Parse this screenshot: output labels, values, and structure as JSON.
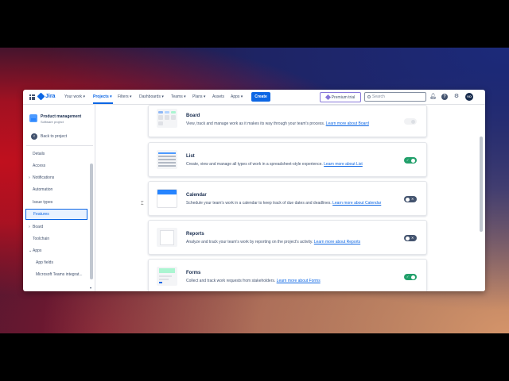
{
  "nav": {
    "logo": "Jira",
    "items": [
      "Your work ▾",
      "Projects ▾",
      "Filters ▾",
      "Dashboards ▾",
      "Teams ▾",
      "Plans ▾",
      "Assets",
      "Apps ▾"
    ],
    "create": "Create",
    "premium": "Premium trial",
    "search_placeholder": "Search",
    "avatar_initials": "VO"
  },
  "sidebar": {
    "project_name": "Product management",
    "project_type": "Software project",
    "back": "Back to project",
    "items": [
      {
        "label": "Details",
        "chevron": ""
      },
      {
        "label": "Access",
        "chevron": ""
      },
      {
        "label": "Notifications",
        "chevron": "›"
      },
      {
        "label": "Automation",
        "chevron": ""
      },
      {
        "label": "Issue types",
        "chevron": ""
      },
      {
        "label": "Features",
        "chevron": ""
      },
      {
        "label": "Board",
        "chevron": "›"
      },
      {
        "label": "Toolchain",
        "chevron": ""
      },
      {
        "label": "Apps",
        "chevron": "⌄"
      },
      {
        "label": "App fields",
        "chevron": ""
      },
      {
        "label": "Microsoft Teams integrat...",
        "chevron": ""
      }
    ]
  },
  "features": [
    {
      "title": "Board",
      "desc": "View, track and manage work as it makes its way through your team's process.",
      "link": "Learn more about Board",
      "toggle": "disabled"
    },
    {
      "title": "List",
      "desc": "Create, view and manage all types of work in a spreadsheet-style experience.",
      "link": "Learn more about List",
      "toggle": "on"
    },
    {
      "title": "Calendar",
      "desc": "Schedule your team's work in a calendar to keep track of due dates and deadlines.",
      "link": "Learn more about Calendar",
      "toggle": "off"
    },
    {
      "title": "Reports",
      "desc": "Analyze and track your team's work by reporting on the project's activity.",
      "link": "Learn more about Reports",
      "toggle": "off"
    },
    {
      "title": "Forms",
      "desc": "Collect and track work requests from stakeholders.",
      "link": "Learn more about Forms",
      "toggle": "on"
    }
  ],
  "colors": {
    "accent": "#0c66e4",
    "toggle_on": "#22a06b",
    "toggle_off": "#44546f"
  }
}
